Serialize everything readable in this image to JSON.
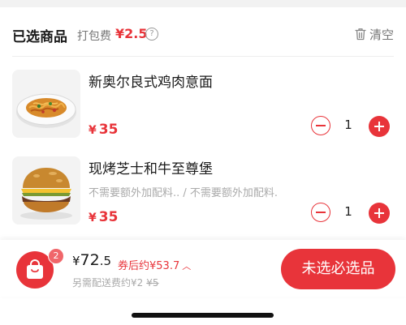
{
  "header": {
    "title": "已选商品",
    "packing_label": "打包费",
    "packing_fee": "¥2.5",
    "help_glyph": "?",
    "clear_label": "清空"
  },
  "items": [
    {
      "name": "新奥尔良式鸡肉意面",
      "note": "",
      "currency": "¥",
      "price": "35",
      "quantity": "1"
    },
    {
      "name": "现烤芝士和牛至尊堡",
      "note": "不需要额外加配料.. / 不需要额外加配料.",
      "currency": "¥",
      "price": "35",
      "quantity": "1"
    }
  ],
  "cart": {
    "badge_count": "2",
    "currency": "¥",
    "total_int": "72",
    "total_dec": ".5",
    "discount_text": "券后约¥53.7",
    "delivery_text": "另需配送费约¥2",
    "delivery_original": "¥5",
    "checkout_label": "未选必选品"
  },
  "colors": {
    "accent": "#e8343a",
    "muted": "#aaaaaa",
    "badge": "#f0666a"
  }
}
